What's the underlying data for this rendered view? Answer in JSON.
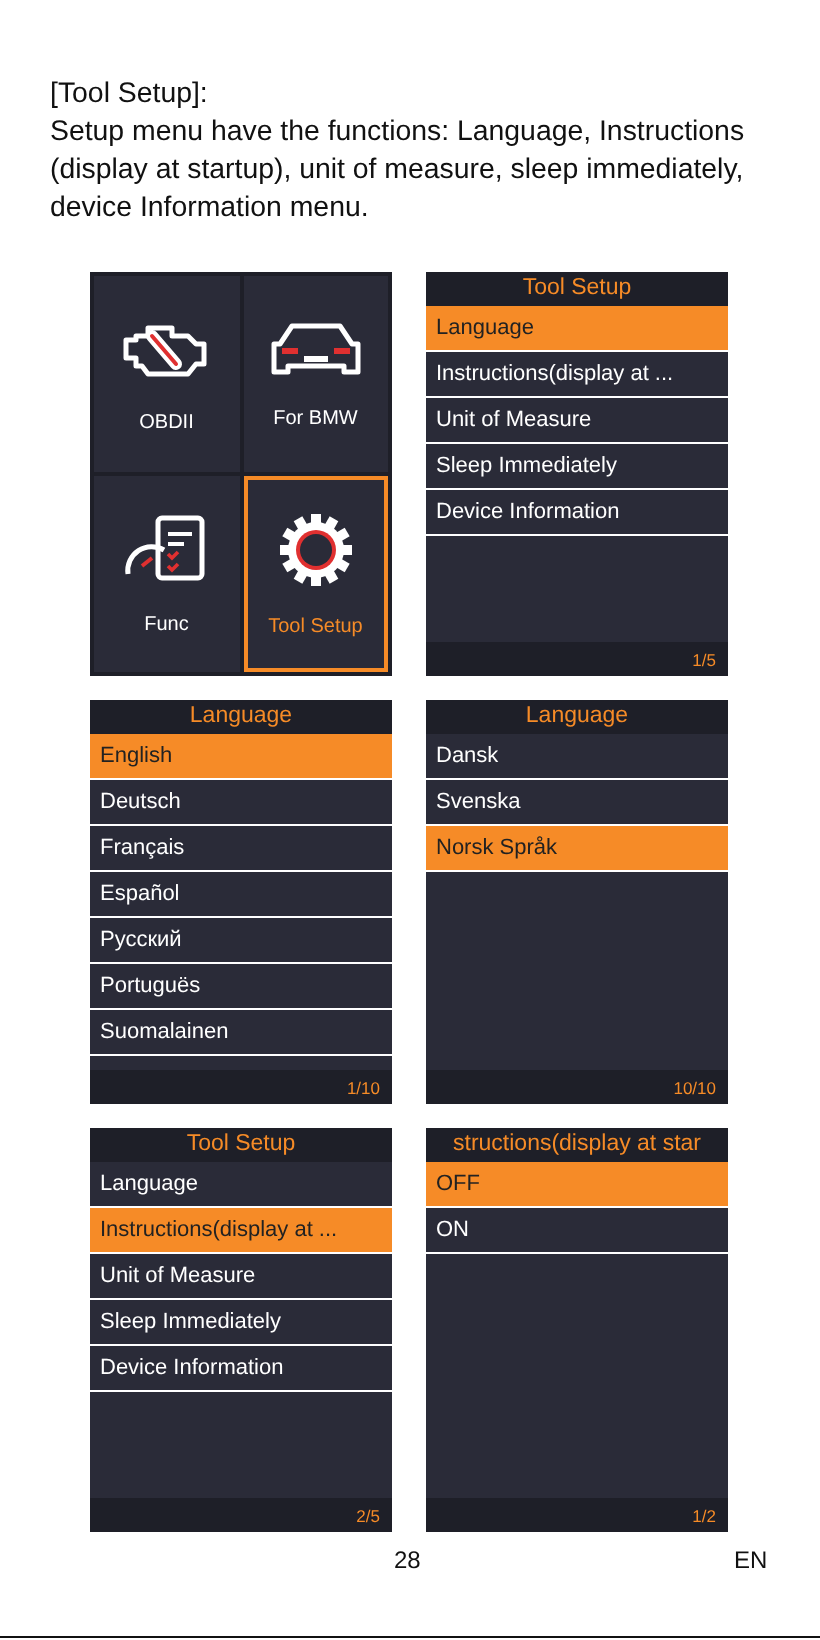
{
  "intro": {
    "title": "[Tool Setup]:",
    "text": "Setup menu have the functions: Language, Instructions (display at startup), unit of measure, sleep immediately, device Information menu."
  },
  "screens": [
    {
      "kind": "home",
      "tiles": [
        {
          "label": "OBDII",
          "selected": false
        },
        {
          "label": "For BMW",
          "selected": false
        },
        {
          "label": "Func",
          "selected": false
        },
        {
          "label": "Tool Setup",
          "selected": true
        }
      ]
    },
    {
      "kind": "menu",
      "title": "Tool Setup",
      "items": [
        {
          "label": "Language",
          "selected": true
        },
        {
          "label": "Instructions(display at ...",
          "selected": false
        },
        {
          "label": "Unit of Measure",
          "selected": false
        },
        {
          "label": "Sleep Immediately",
          "selected": false
        },
        {
          "label": "Device Information",
          "selected": false
        }
      ],
      "page": "1/5"
    },
    {
      "kind": "menu",
      "title": "Language",
      "items": [
        {
          "label": "English",
          "selected": true
        },
        {
          "label": "Deutsch",
          "selected": false
        },
        {
          "label": "Français",
          "selected": false
        },
        {
          "label": "Español",
          "selected": false
        },
        {
          "label": "Русский",
          "selected": false
        },
        {
          "label": "Portuguës",
          "selected": false
        },
        {
          "label": "Suomalainen",
          "selected": false
        }
      ],
      "page": "1/10"
    },
    {
      "kind": "menu",
      "title": "Language",
      "items": [
        {
          "label": "Dansk",
          "selected": false
        },
        {
          "label": "Svenska",
          "selected": false
        },
        {
          "label": "Norsk Språk",
          "selected": true
        }
      ],
      "page": "10/10"
    },
    {
      "kind": "menu",
      "title": "Tool Setup",
      "items": [
        {
          "label": "Language",
          "selected": false
        },
        {
          "label": "Instructions(display at ...",
          "selected": true
        },
        {
          "label": "Unit of Measure",
          "selected": false
        },
        {
          "label": "Sleep Immediately",
          "selected": false
        },
        {
          "label": "Device Information",
          "selected": false
        }
      ],
      "page": "2/5"
    },
    {
      "kind": "menu",
      "title": "structions(display at star",
      "items": [
        {
          "label": "OFF",
          "selected": true
        },
        {
          "label": "ON",
          "selected": false
        }
      ],
      "page": "1/2"
    }
  ],
  "footer": {
    "page_number": "28",
    "language": "EN"
  }
}
